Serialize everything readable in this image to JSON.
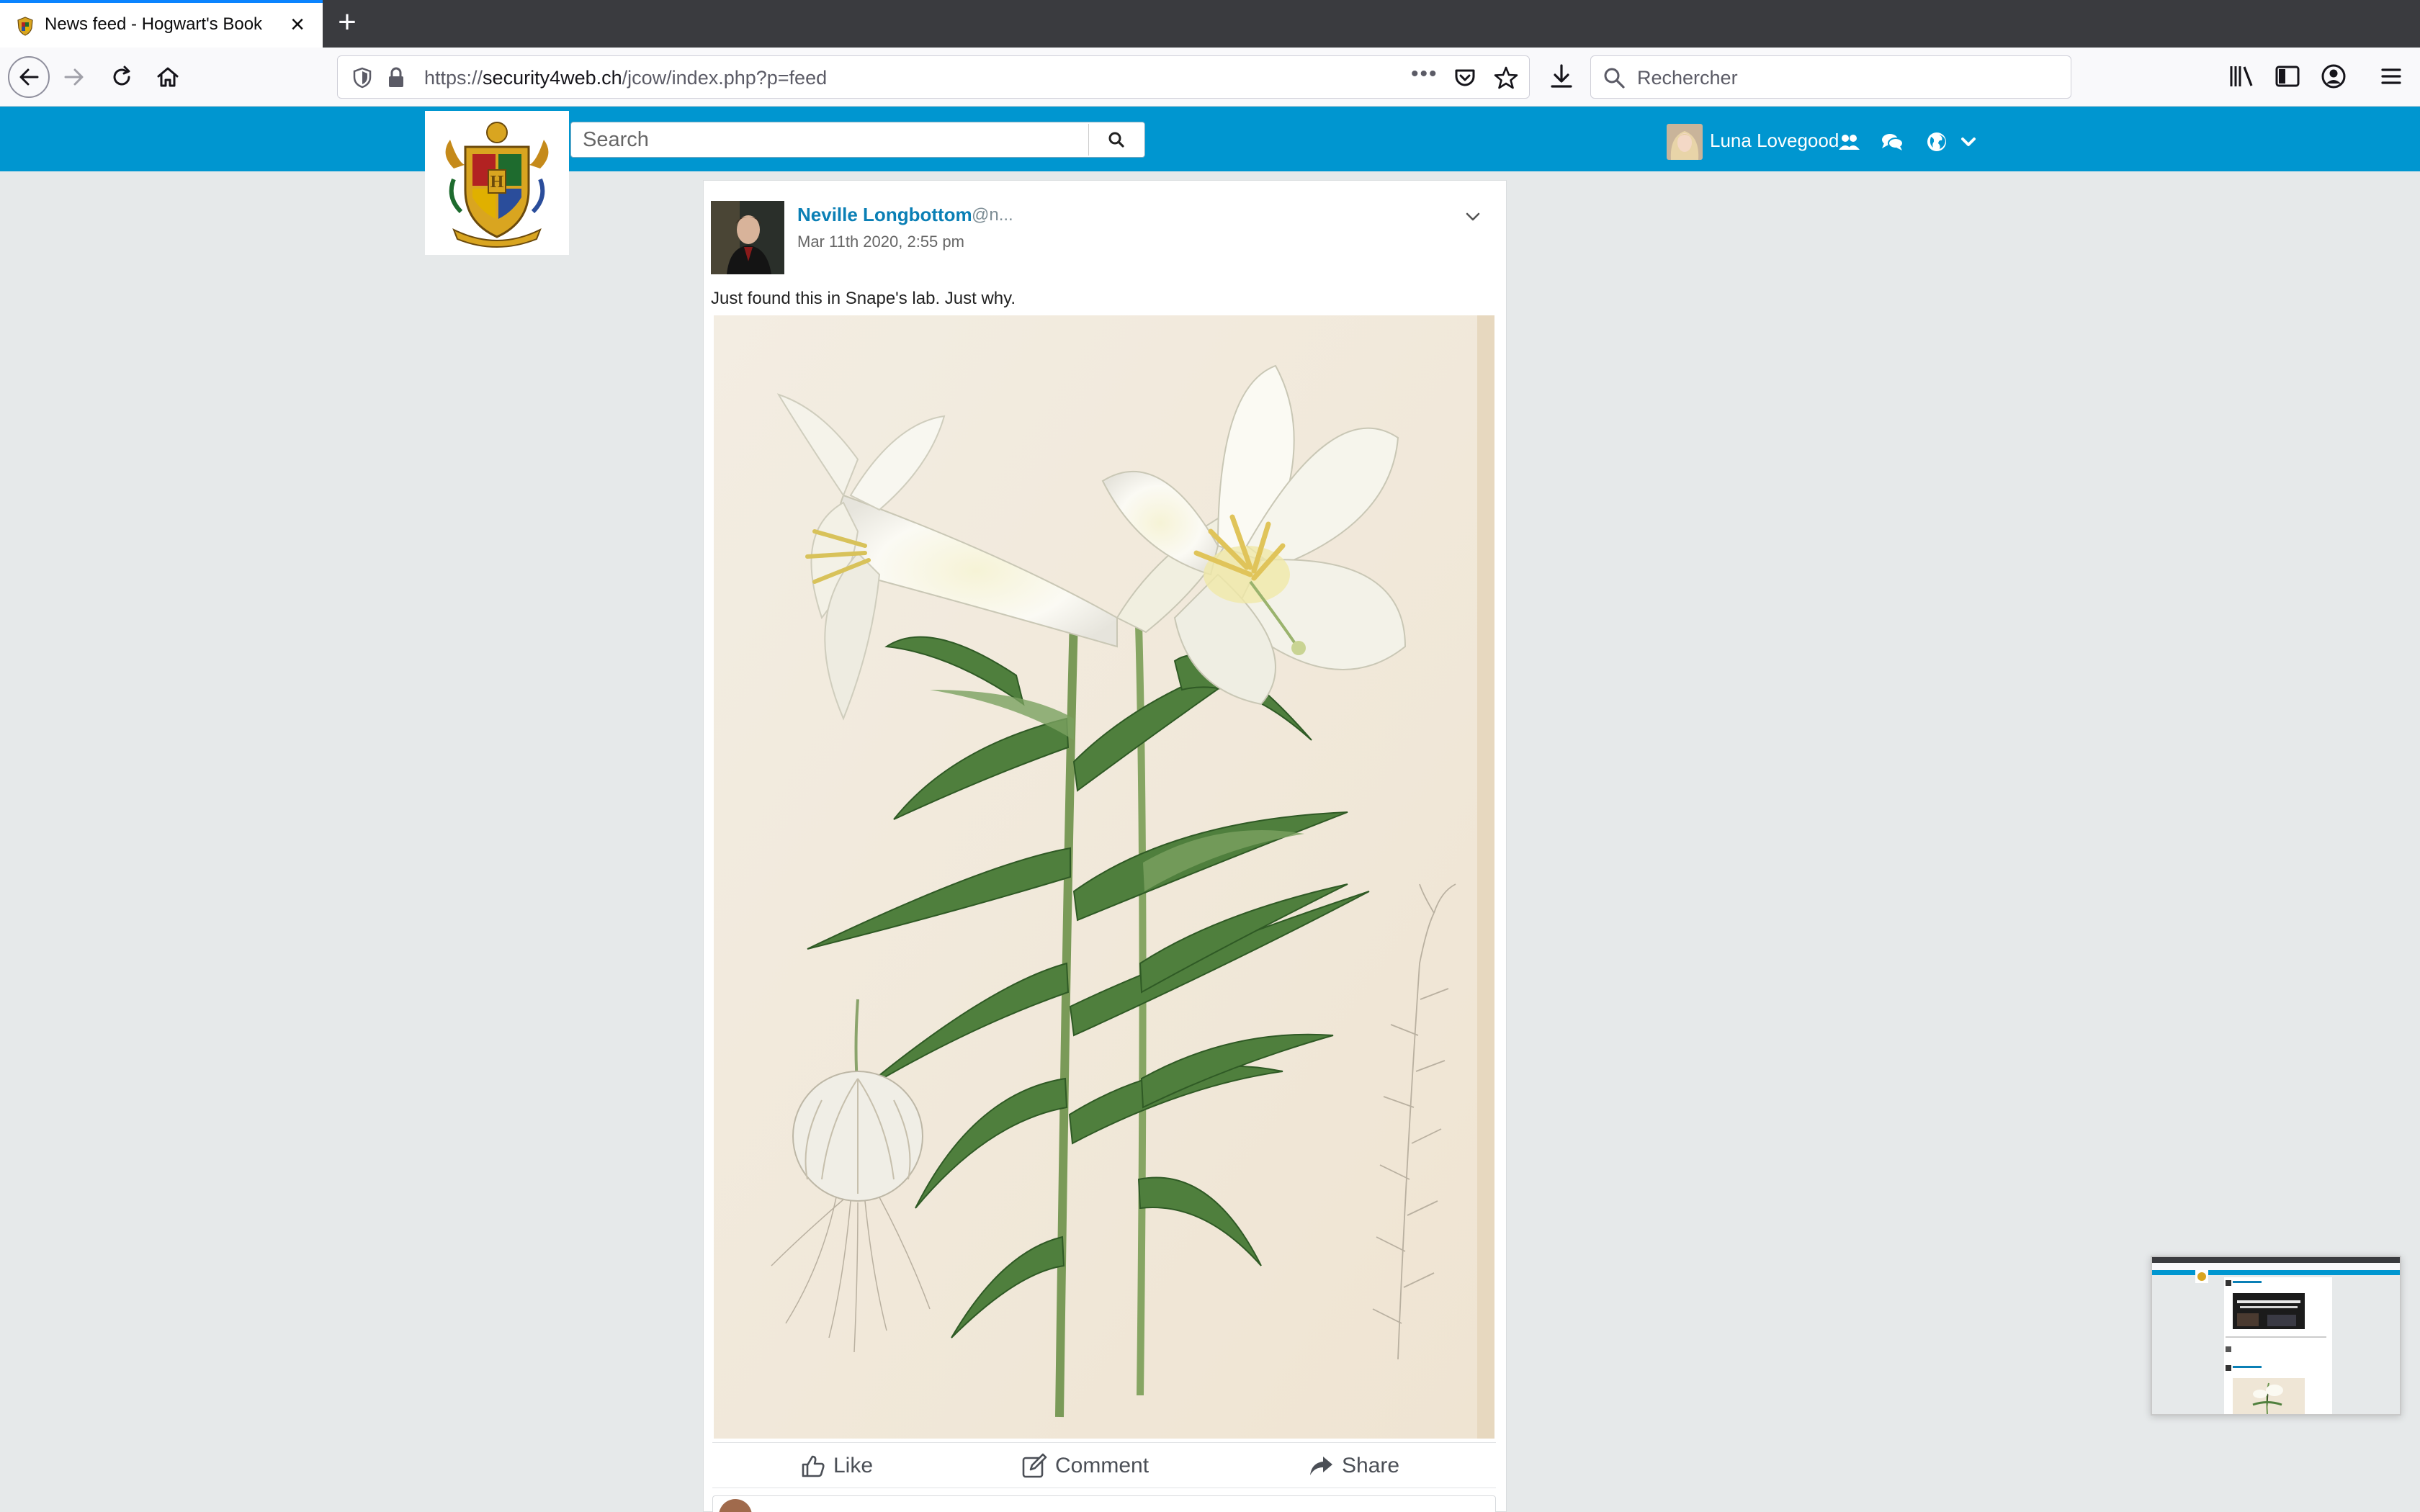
{
  "browser": {
    "tab_title": "News feed - Hogwart's Book",
    "url_prefix": "https://",
    "url_host": "security4web.ch",
    "url_path": "/jcow/index.php?p=feed",
    "search_placeholder": "Rechercher",
    "accent": "#0a84ff"
  },
  "site": {
    "header_color": "#0096d0",
    "search_placeholder": "Search",
    "current_user": "Luna Lovegood",
    "link_color": "#0a7fb5"
  },
  "post": {
    "author": "Neville Longbottom",
    "handle": "@n...",
    "date": "Mar 11th 2020, 2:55 pm",
    "text": "Just found this in Snape's lab. Just why.",
    "image_subject": "botanical-illustration-white-lily",
    "actions": {
      "like": "Like",
      "comment": "Comment",
      "share": "Share"
    }
  },
  "icons": {
    "tab": "hogwarts-crest-icon",
    "nav": [
      "back-arrow-icon",
      "forward-arrow-icon",
      "reload-icon",
      "home-icon"
    ],
    "toolbar": [
      "library-icon",
      "sidebar-icon",
      "account-icon",
      "menu-icon"
    ],
    "header": [
      "friends-icon",
      "chat-icon",
      "globe-icon",
      "chevron-down-icon"
    ]
  }
}
